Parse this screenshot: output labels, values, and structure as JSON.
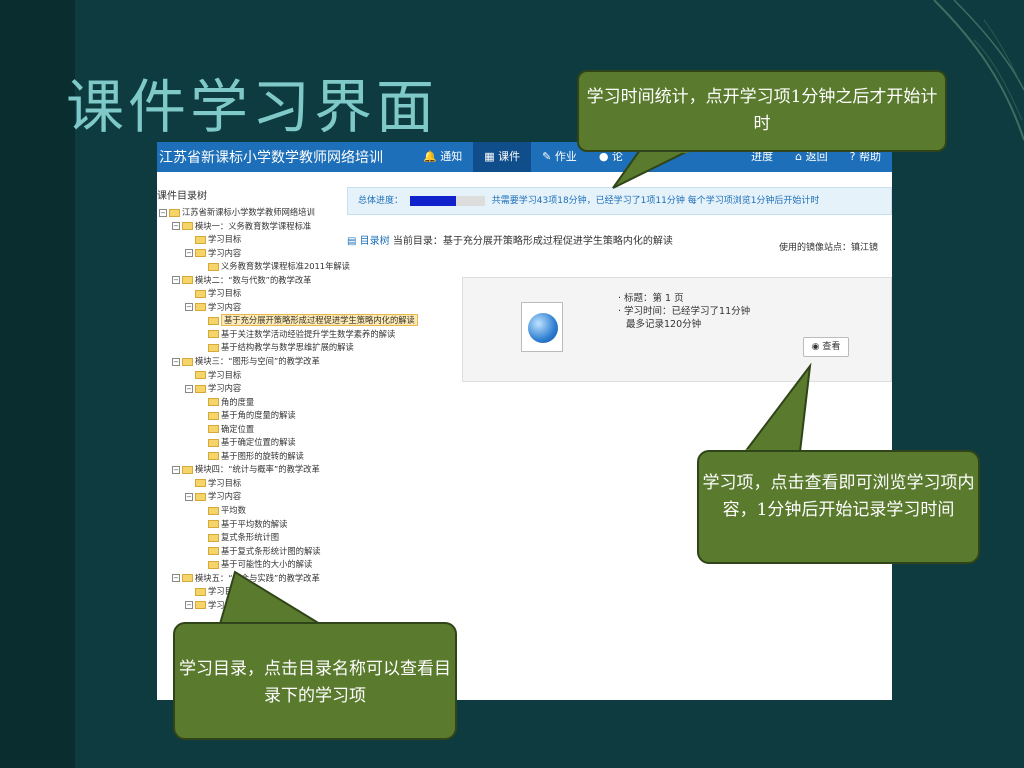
{
  "slide": {
    "title": "课件学习界面"
  },
  "app": {
    "site_title": "江苏省新课标小学数学教师网络培训",
    "nav": [
      {
        "label": "通知",
        "icon": "bell-icon"
      },
      {
        "label": "课件",
        "icon": "film-icon"
      },
      {
        "label": "作业",
        "icon": "pencil-icon"
      },
      {
        "label": "论",
        "icon": "comment-icon"
      },
      {
        "label": "进度",
        "icon": "chart-icon"
      },
      {
        "label": "返回",
        "icon": "home-icon"
      },
      {
        "label": "帮助",
        "icon": "help-icon"
      }
    ],
    "tree_title": "课件目录树",
    "tree": [
      "江苏省新课标小学数学教师网络培训",
      "模块一：义务教育数学课程标准",
      "学习目标",
      "学习内容",
      "义务教育数学课程标准2011年解读",
      "模块二：“数与代数”的教学改革",
      "学习目标",
      "学习内容",
      "基于充分展开策略形成过程促进学生策略内化的解读",
      "基于关注数学活动经验提升学生数学素养的解读",
      "基于结构教学与数学思维扩展的解读",
      "模块三：“图形与空间”的教学改革",
      "学习目标",
      "学习内容",
      "角的度量",
      "基于角的度量的解读",
      "确定位置",
      "基于确定位置的解读",
      "基于图形的旋转的解读",
      "模块四：“统计与概率”的教学改革",
      "学习目标",
      "学习内容",
      "平均数",
      "基于平均数的解读",
      "复式条形统计图",
      "基于复式条形统计图的解读",
      "基于可能性的大小的解读",
      "模块五：“综合与实践”的教学改革",
      "学习目标",
      "学习内容"
    ],
    "progress": {
      "label": "总体进度：",
      "fraction": 0.62,
      "text": "共需要学习43项18分钟，已经学习了1项11分钟  每个学习项浏览1分钟后开始计时"
    },
    "directory": {
      "link": "目录树",
      "current": "当前目录：基于充分展开策略形成过程促进学生策略内化的解读",
      "mirror": "使用的镜像站点：镇江镜"
    },
    "item": {
      "title": "· 标题：第 1 页",
      "time": "· 学习时间：已经学习了11分钟",
      "max": "最多记录120分钟",
      "view_label": "查看"
    }
  },
  "callouts": {
    "top": "学习时间统计，点开学习项1分钟之后才开始计时",
    "right": "学习项，点击查看即可浏览学习项内容，1分钟后开始记录学习时间",
    "bottom": "学习目录，点击目录名称可以查看目录下的学习项"
  },
  "colors": {
    "background": "#0d3b3f",
    "title": "#7fc9c9",
    "callout": "#5a7a2e",
    "nav": "#1c6fb8"
  }
}
